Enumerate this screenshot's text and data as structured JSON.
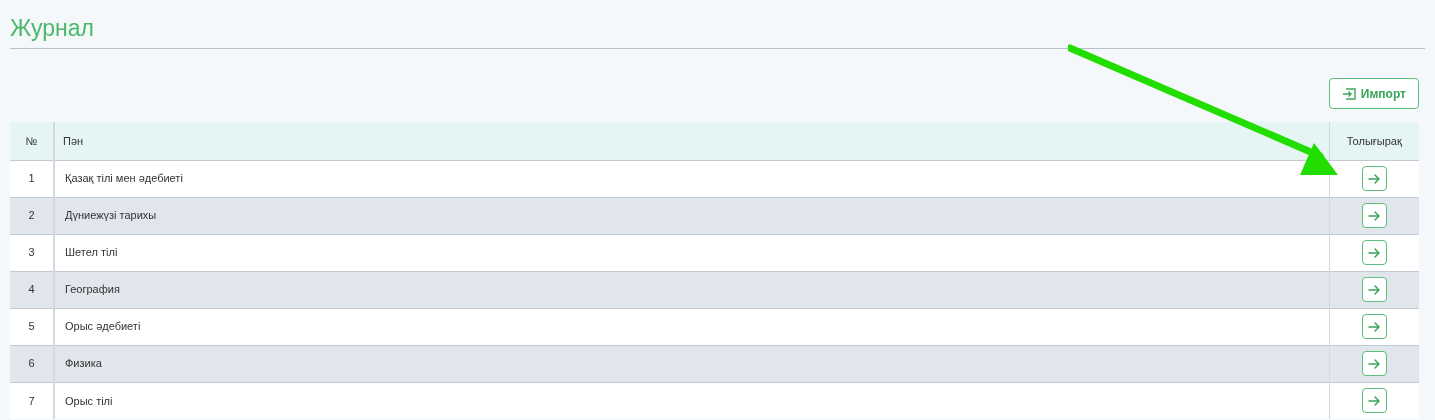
{
  "title": "Журнал",
  "import_button": {
    "label": "Импорт"
  },
  "table": {
    "columns": [
      "№",
      "Пән",
      "Толығырақ"
    ],
    "rows": [
      {
        "number": "1",
        "subject": "Қазақ тілі мен әдебиеті"
      },
      {
        "number": "2",
        "subject": "Дүниежүзі тарихы"
      },
      {
        "number": "3",
        "subject": "Шетел тілі"
      },
      {
        "number": "4",
        "subject": "География"
      },
      {
        "number": "5",
        "subject": "Орыс әдебиеті"
      },
      {
        "number": "6",
        "subject": "Физика"
      },
      {
        "number": "7",
        "subject": "Орыс тілі"
      }
    ]
  }
}
